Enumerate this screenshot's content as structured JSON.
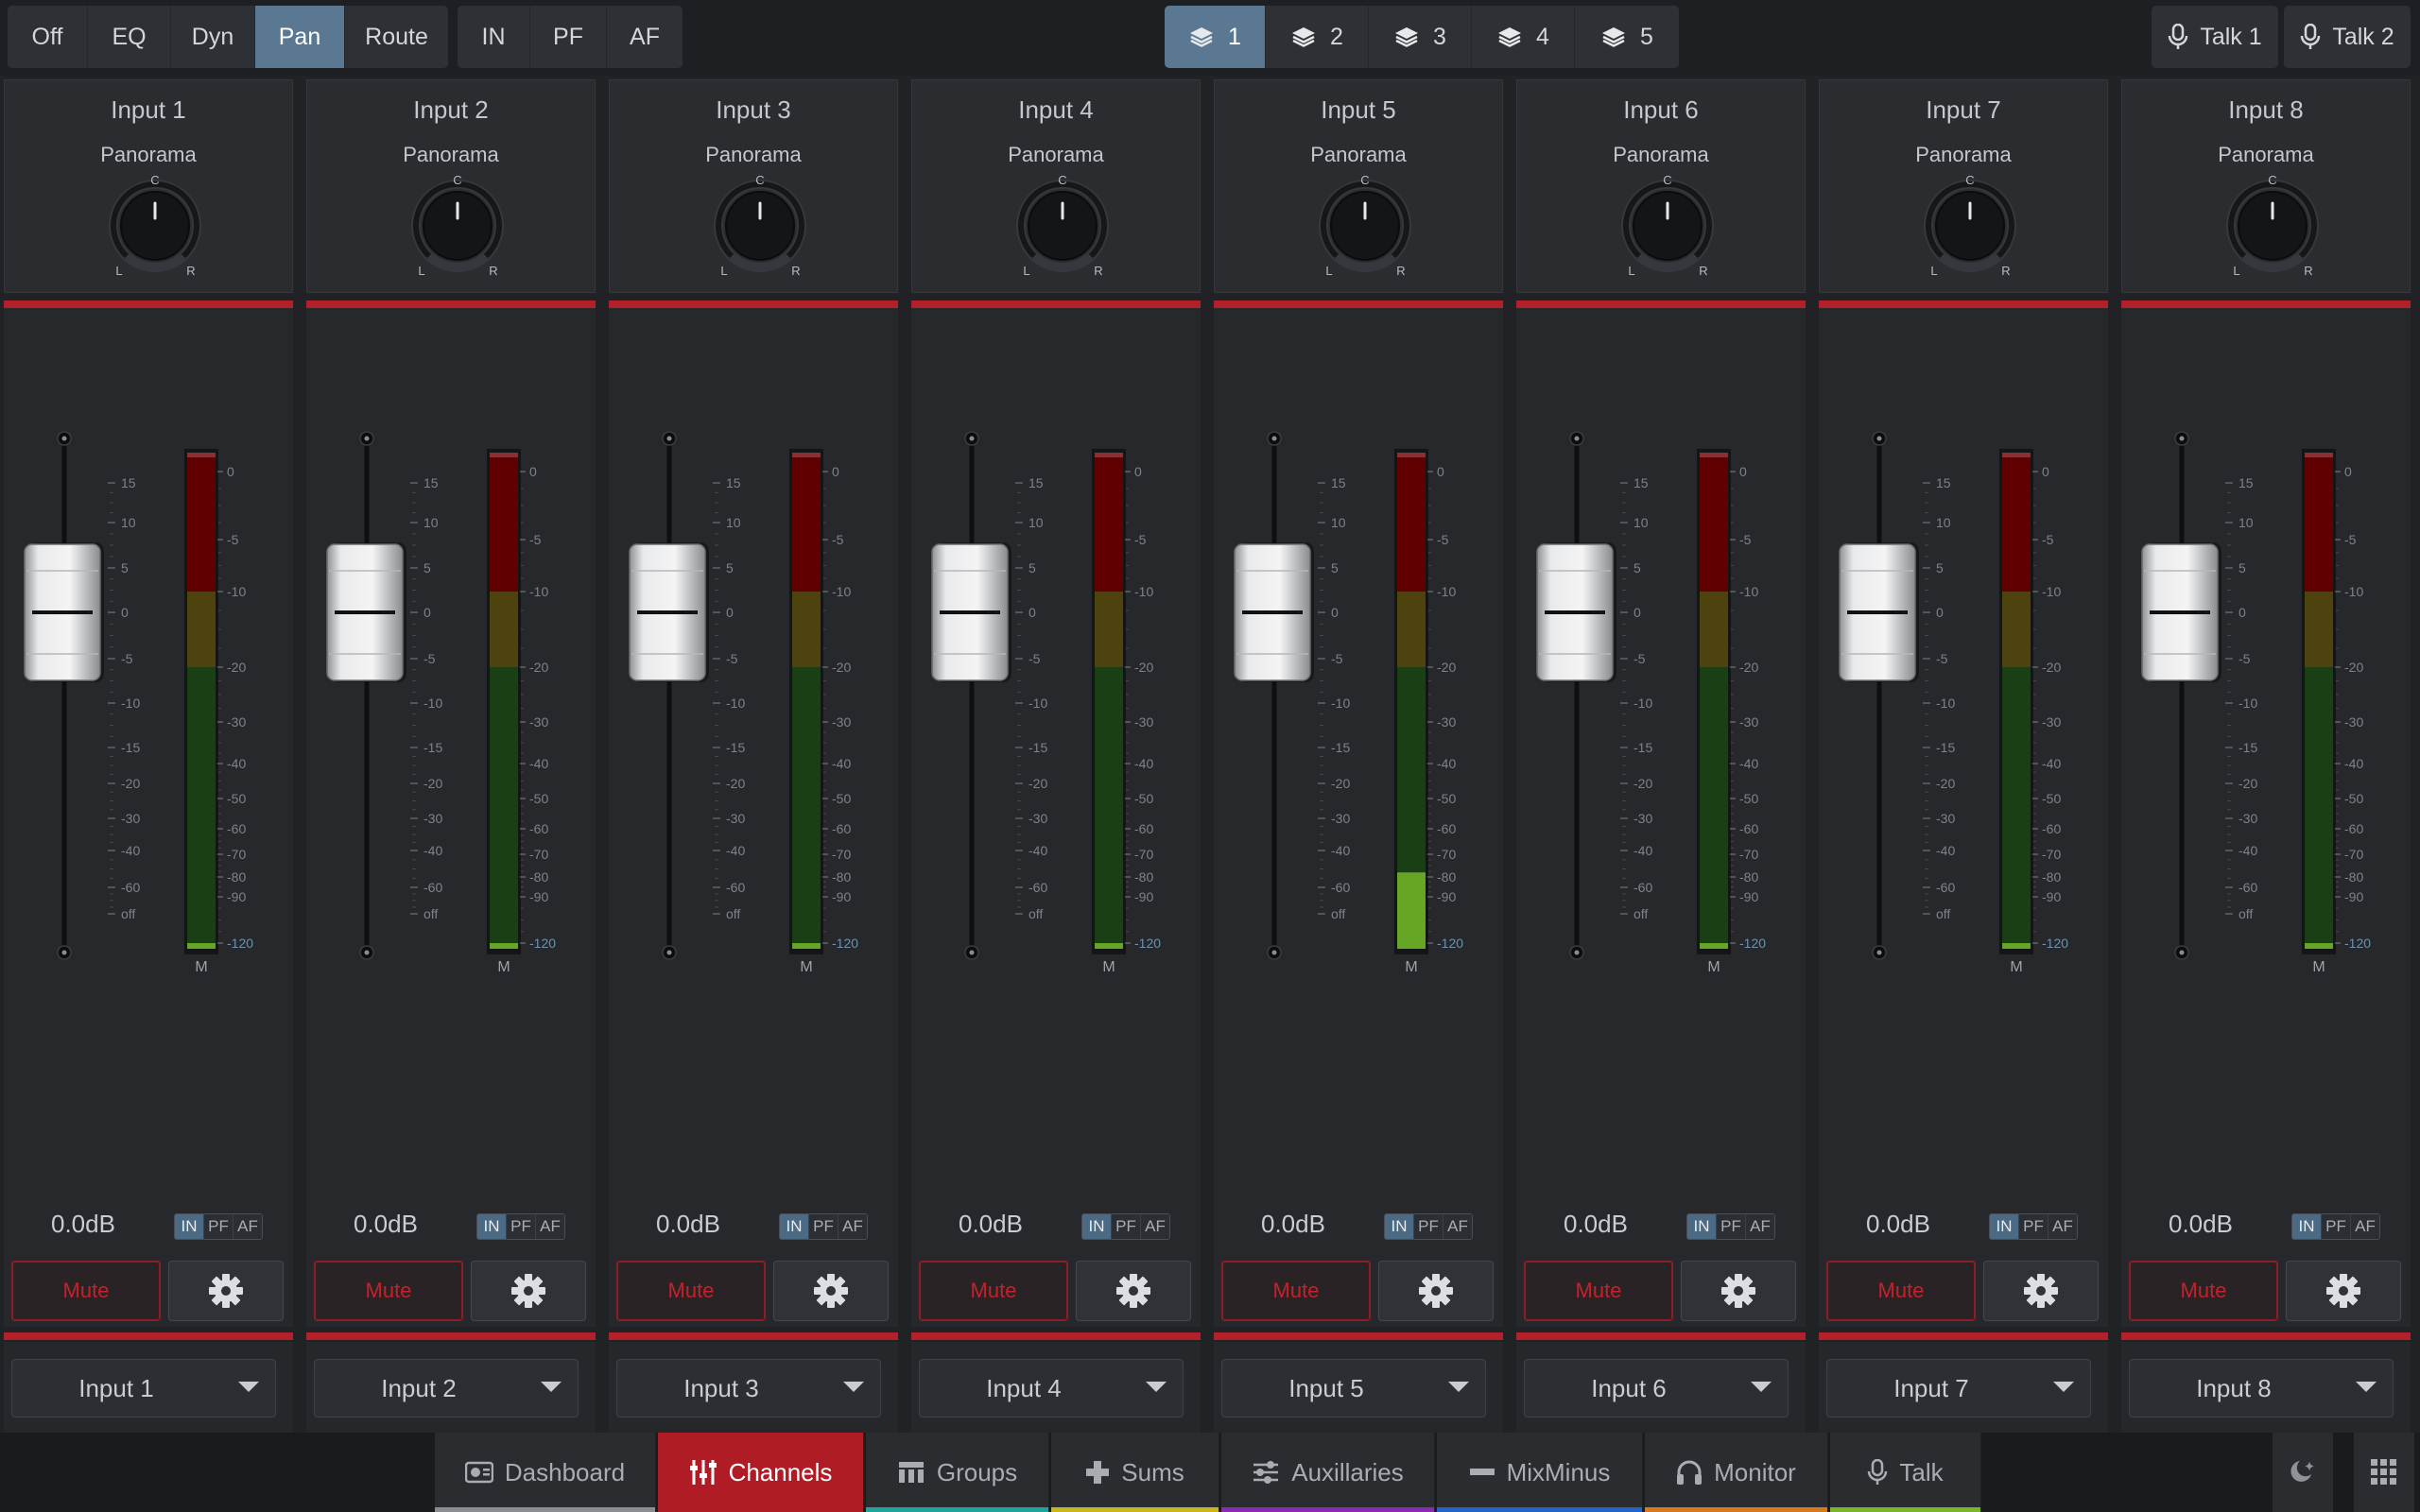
{
  "top_bar": {
    "view_modes": [
      {
        "label": "Off",
        "active": false
      },
      {
        "label": "EQ",
        "active": false
      },
      {
        "label": "Dyn",
        "active": false
      },
      {
        "label": "Pan",
        "active": true
      },
      {
        "label": "Route",
        "active": false
      }
    ],
    "taps": [
      {
        "label": "IN"
      },
      {
        "label": "PF"
      },
      {
        "label": "AF"
      }
    ],
    "layers": [
      {
        "label": "1",
        "icon": "layers-icon",
        "active": true
      },
      {
        "label": "2",
        "icon": "layers-icon",
        "active": false
      },
      {
        "label": "3",
        "icon": "layers-icon",
        "active": false
      },
      {
        "label": "4",
        "icon": "layers-icon",
        "active": false
      },
      {
        "label": "5",
        "icon": "layers-icon",
        "active": false
      }
    ],
    "talk_buttons": [
      {
        "label": "Talk 1",
        "icon": "microphone-icon"
      },
      {
        "label": "Talk 2",
        "icon": "microphone-icon"
      }
    ]
  },
  "meter_scale": {
    "fader_ticks": [
      "15",
      "10",
      "5",
      "0",
      "-5",
      "-10",
      "-15",
      "-20",
      "-30",
      "-40",
      "-60",
      "off"
    ],
    "meter_ticks": [
      "0",
      "-5",
      "-10",
      "-20",
      "-30",
      "-40",
      "-50",
      "-60",
      "-70",
      "-80",
      "-90",
      "-120"
    ],
    "meter_label": "M",
    "colors": {
      "red": "#600000",
      "yellow": "#4e420f",
      "green": "#1a3f14",
      "green_lit": "#66a526",
      "accent_red": "#b3202a"
    }
  },
  "channels": [
    {
      "title": "Input 1",
      "pan_label": "Panorama",
      "pan_marks": {
        "center": "C",
        "left": "L",
        "right": "R"
      },
      "pan_position": 0,
      "fader_db": 0,
      "meter_level_db": -120,
      "value": "0.0dB",
      "taps": [
        {
          "label": "IN",
          "active": true
        },
        {
          "label": "PF",
          "active": false
        },
        {
          "label": "AF",
          "active": false
        }
      ],
      "mute_label": "Mute",
      "settings_icon": "gear-icon",
      "source": "Input 1"
    },
    {
      "title": "Input 2",
      "pan_label": "Panorama",
      "pan_marks": {
        "center": "C",
        "left": "L",
        "right": "R"
      },
      "pan_position": 0,
      "fader_db": 0,
      "meter_level_db": -120,
      "value": "0.0dB",
      "taps": [
        {
          "label": "IN",
          "active": true
        },
        {
          "label": "PF",
          "active": false
        },
        {
          "label": "AF",
          "active": false
        }
      ],
      "mute_label": "Mute",
      "settings_icon": "gear-icon",
      "source": "Input 2"
    },
    {
      "title": "Input 3",
      "pan_label": "Panorama",
      "pan_marks": {
        "center": "C",
        "left": "L",
        "right": "R"
      },
      "pan_position": 0,
      "fader_db": 0,
      "meter_level_db": -120,
      "value": "0.0dB",
      "taps": [
        {
          "label": "IN",
          "active": true
        },
        {
          "label": "PF",
          "active": false
        },
        {
          "label": "AF",
          "active": false
        }
      ],
      "mute_label": "Mute",
      "settings_icon": "gear-icon",
      "source": "Input 3"
    },
    {
      "title": "Input 4",
      "pan_label": "Panorama",
      "pan_marks": {
        "center": "C",
        "left": "L",
        "right": "R"
      },
      "pan_position": 0,
      "fader_db": 0,
      "meter_level_db": -120,
      "value": "0.0dB",
      "taps": [
        {
          "label": "IN",
          "active": true
        },
        {
          "label": "PF",
          "active": false
        },
        {
          "label": "AF",
          "active": false
        }
      ],
      "mute_label": "Mute",
      "settings_icon": "gear-icon",
      "source": "Input 4"
    },
    {
      "title": "Input 5",
      "pan_label": "Panorama",
      "pan_marks": {
        "center": "C",
        "left": "L",
        "right": "R"
      },
      "pan_position": 0,
      "fader_db": 0,
      "meter_level_db": -78,
      "value": "0.0dB",
      "taps": [
        {
          "label": "IN",
          "active": true
        },
        {
          "label": "PF",
          "active": false
        },
        {
          "label": "AF",
          "active": false
        }
      ],
      "mute_label": "Mute",
      "settings_icon": "gear-icon",
      "source": "Input 5"
    },
    {
      "title": "Input 6",
      "pan_label": "Panorama",
      "pan_marks": {
        "center": "C",
        "left": "L",
        "right": "R"
      },
      "pan_position": 0,
      "fader_db": 0,
      "meter_level_db": -120,
      "value": "0.0dB",
      "taps": [
        {
          "label": "IN",
          "active": true
        },
        {
          "label": "PF",
          "active": false
        },
        {
          "label": "AF",
          "active": false
        }
      ],
      "mute_label": "Mute",
      "settings_icon": "gear-icon",
      "source": "Input 6"
    },
    {
      "title": "Input 7",
      "pan_label": "Panorama",
      "pan_marks": {
        "center": "C",
        "left": "L",
        "right": "R"
      },
      "pan_position": 0,
      "fader_db": 0,
      "meter_level_db": -120,
      "value": "0.0dB",
      "taps": [
        {
          "label": "IN",
          "active": true
        },
        {
          "label": "PF",
          "active": false
        },
        {
          "label": "AF",
          "active": false
        }
      ],
      "mute_label": "Mute",
      "settings_icon": "gear-icon",
      "source": "Input 7"
    },
    {
      "title": "Input 8",
      "pan_label": "Panorama",
      "pan_marks": {
        "center": "C",
        "left": "L",
        "right": "R"
      },
      "pan_position": 0,
      "fader_db": 0,
      "meter_level_db": -120,
      "value": "0.0dB",
      "taps": [
        {
          "label": "IN",
          "active": true
        },
        {
          "label": "PF",
          "active": false
        },
        {
          "label": "AF",
          "active": false
        }
      ],
      "mute_label": "Mute",
      "settings_icon": "gear-icon",
      "source": "Input 8"
    }
  ],
  "bottom_nav": {
    "tabs": [
      {
        "label": "Dashboard",
        "icon": "dashboard-icon",
        "active": false,
        "accent": "#8a8d91"
      },
      {
        "label": "Channels",
        "icon": "channels-icon",
        "active": true,
        "accent": "#b01c26"
      },
      {
        "label": "Groups",
        "icon": "groups-icon",
        "active": false,
        "accent": "#1fa59a"
      },
      {
        "label": "Sums",
        "icon": "plus-icon",
        "active": false,
        "accent": "#c9b51c"
      },
      {
        "label": "Auxillaries",
        "icon": "auxiliaries-icon",
        "active": false,
        "accent": "#8a2bb5"
      },
      {
        "label": "MixMinus",
        "icon": "minus-icon",
        "active": false,
        "accent": "#2466c7"
      },
      {
        "label": "Monitor",
        "icon": "headphones-icon",
        "active": false,
        "accent": "#d77a1f"
      },
      {
        "label": "Talk",
        "icon": "microphone-icon",
        "active": false,
        "accent": "#7cb52a"
      }
    ],
    "right_icons": [
      "night-mode-icon",
      "apps-grid-icon"
    ]
  }
}
